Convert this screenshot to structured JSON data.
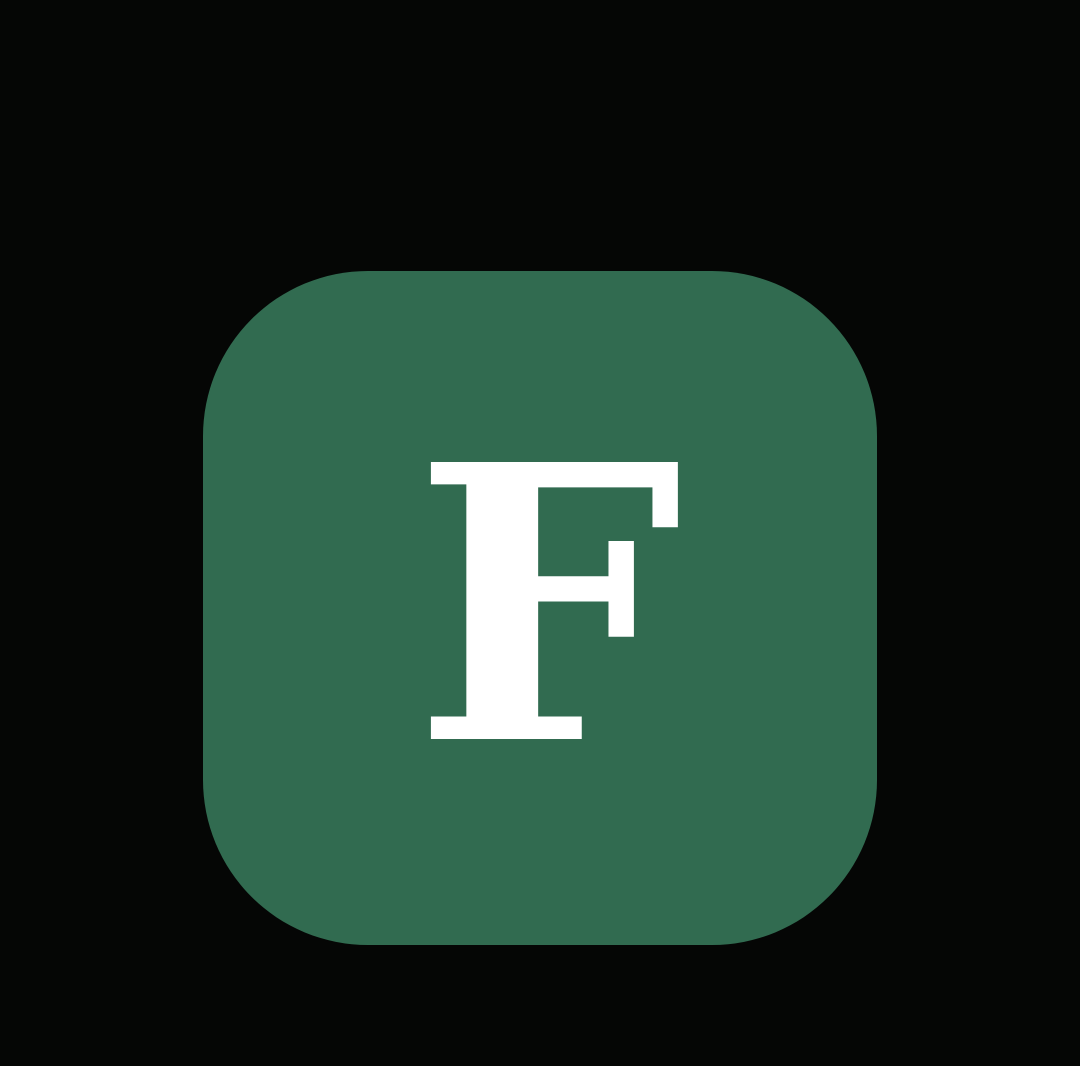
{
  "app_icon": {
    "letter": "F",
    "icon_name": "app-logo-icon",
    "background_color": "#316b50",
    "letter_color": "#ffffff"
  },
  "screen": {
    "background_color": "#050605"
  }
}
